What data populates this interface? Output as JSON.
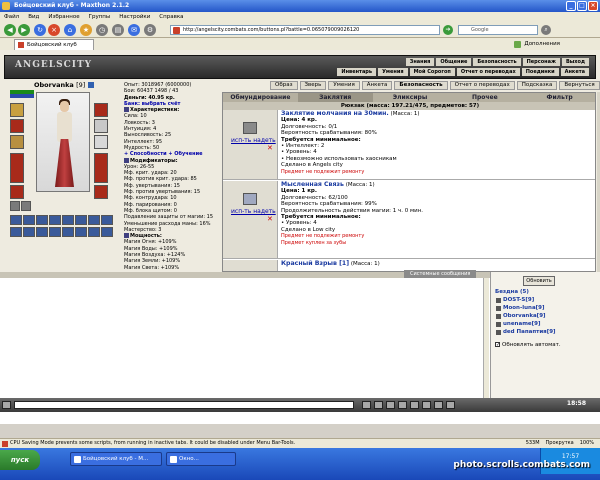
{
  "window": {
    "title": "Бойцовский клуб - Maxthon 2.1.2"
  },
  "menu": [
    "Файл",
    "Вид",
    "Избранное",
    "Группы",
    "Настройки",
    "Справка"
  ],
  "browser": {
    "url": "http://angelscity.combats.com/buttons.pl?battle=0.065079009026120",
    "search_placeholder": "Google",
    "tab_title": "Бойцовский клуб",
    "addons_label": "Дополнения"
  },
  "game": {
    "logo": "ANGELSCITY",
    "top_nav_row1": [
      "Знания",
      "Общение",
      "Безопасность",
      "Персонаж",
      "Выход"
    ],
    "top_nav_row2": [
      "Инвентарь",
      "Умения",
      "Мой Сорогоп",
      "Отчет о переводах",
      "Поединки",
      "Анкета"
    ],
    "sub_nav": [
      "Образ",
      "Зверь",
      "Умения",
      "Анкета",
      "Безопасность",
      "Отчет о переводах",
      "Подсказка",
      "Вернуться"
    ],
    "character": {
      "name": "Oborvanka",
      "level": "[9]",
      "hp": "1500/1500",
      "mana": "100/100"
    },
    "stats": {
      "experience": "Опыт: 3018967 (6000000)",
      "battles": "Бои: 60437",
      "wins": "1498 / 43",
      "money": "Деньги: 40.95 кр.",
      "bank": "Банк: выбрать счёт",
      "char_section": "Характеристики:",
      "attributes": [
        "Сила: 10",
        "Ловкость: 3",
        "Интуиция: 4",
        "Выносливость: 25",
        "Интеллект: 95",
        "Мудрость: 50"
      ],
      "abilities_link": "+ Способности  + Обучение",
      "mods_section": "Модификаторы:",
      "modifiers": [
        "Урон: 26-55",
        "Мф. крит. удара: 20",
        "Мф. против крит. удара: 85",
        "Мф. увертывания: 15",
        "Мф. против увертывания: 15",
        "Мф. контрудара: 10",
        "Мф. парирования: 0",
        "Мф. блока щитом: 0",
        "Подавление защиты от магии: 15",
        "Уменьшение расхода маны: 16%",
        "Мастерство: 3"
      ],
      "power_section": "Мощность:",
      "power": [
        "Магия Огня: +109%",
        "Магия Воды: +109%",
        "Магия Воздуха: +124%",
        "Магия Земли: +109%",
        "Магия Света: +109%"
      ]
    },
    "inventory": {
      "tabs": [
        "Обмундирование",
        "Заклятия",
        "Эликсиры",
        "Прочее",
        "Фильтр"
      ],
      "active_tab": "Заклятия",
      "header": "Рюкзак (масса: 197.21/475, предметов: 57)",
      "use_label": "исп-ть надеть",
      "items": [
        {
          "name": "Заклятие молчания на 30мин.",
          "mass": "(Масса: 1)",
          "price": "Цена: 4 кр.",
          "durability": "Долговечность: 0/1",
          "probability": "Вероятность срабатывания: 80%",
          "req_title": "Требуется минимальное:",
          "reqs": [
            "• Интеллект: 2",
            "• Уровень: 4",
            "• Невозможно использовать хаосникам"
          ],
          "made_in": "Сделано в Angels city",
          "note": "Предмет не подлежит ремонту"
        },
        {
          "name": "Мысленная Связь",
          "mass": "(Масса: 1)",
          "price": "Цена: 1 кр.",
          "durability": "Долговечность: 62/100",
          "probability": "Вероятность срабатывания: 99%",
          "duration": "Продолжительность действия магии: 1 ч. 0 мин.",
          "req_title": "Требуется минимальное:",
          "reqs": [
            "• Уровень: 4"
          ],
          "made_in": "Сделано в Low city",
          "note": "Предмет не подлежит ремонту",
          "note2": "Предмет куплен за зубы"
        },
        {
          "name": "Красный Взрыв [1]",
          "mass": "(Масса: 1)"
        }
      ]
    }
  },
  "chat": {
    "tab_label": "Системные сообщения",
    "refresh_label": "Обновить",
    "online_title": "Бездна (5)",
    "users": [
      "DOST-S[9]",
      "Moon-luna[9]",
      "Oborvanka[9]",
      "unename[9]",
      "ded Папаптия[9]"
    ],
    "auto_refresh": "Обновлять автомат.",
    "clock": "18:58"
  },
  "status": {
    "text": "CPU Saving Mode prevents some scripts, from running in inactive tabs. It could be disabled under Menu Bar-Tools.",
    "mem": "533M",
    "scroll": "Прокрутка",
    "zoom": "100%"
  },
  "taskbar": {
    "start_label": "пуск",
    "tasks": [
      "Бойцовский клуб - M...",
      "Окно..."
    ],
    "tray_time": "17:57",
    "watermark": "photo.scrolls.combats.com"
  }
}
